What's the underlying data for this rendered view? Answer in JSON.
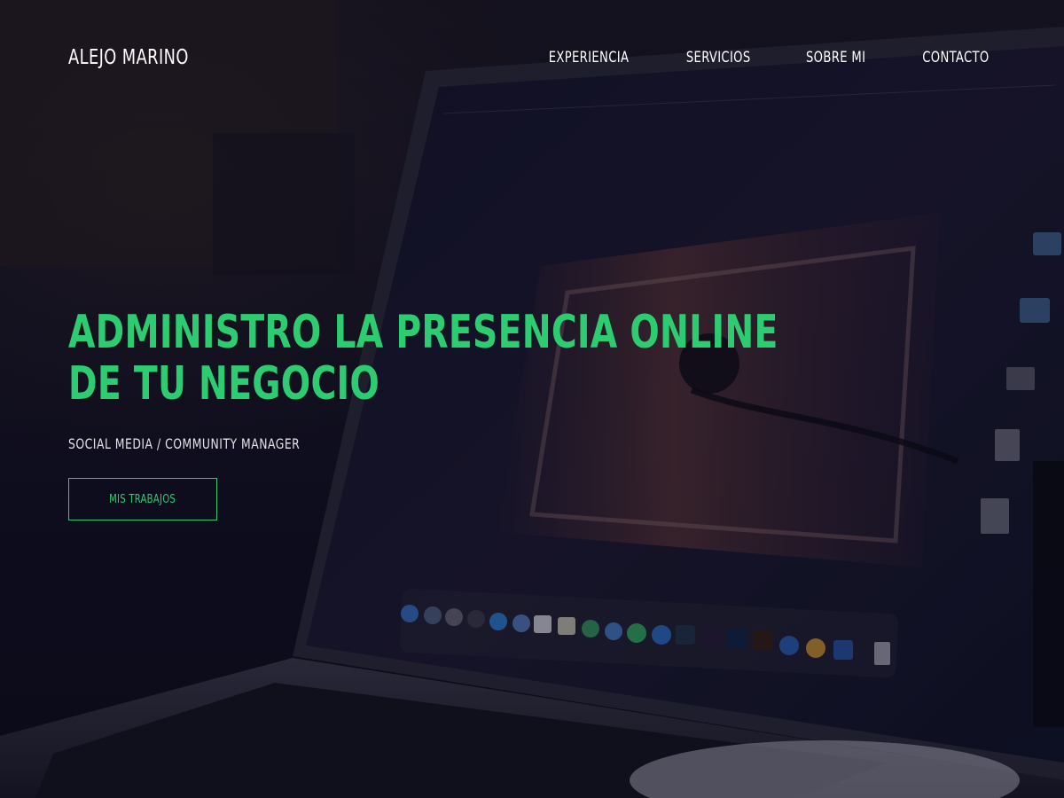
{
  "brand": {
    "name": "ALEJO MARINO"
  },
  "nav": {
    "items": [
      {
        "label": "EXPERIENCIA"
      },
      {
        "label": "SERVICIOS"
      },
      {
        "label": "SOBRE MI"
      },
      {
        "label": "CONTACTO"
      }
    ]
  },
  "hero": {
    "headline_line1": "ADMINISTRO LA PRESENCIA ONLINE",
    "headline_line2": "DE TU NEGOCIO",
    "subtitle": "SOCIAL MEDIA / COMMUNITY MANAGER",
    "cta_label": "MIS TRABAJOS"
  },
  "colors": {
    "accent": "#2ecc71",
    "text": "#ffffff",
    "background": "#121120"
  },
  "icons": {
    "background": "laptop-photo"
  }
}
